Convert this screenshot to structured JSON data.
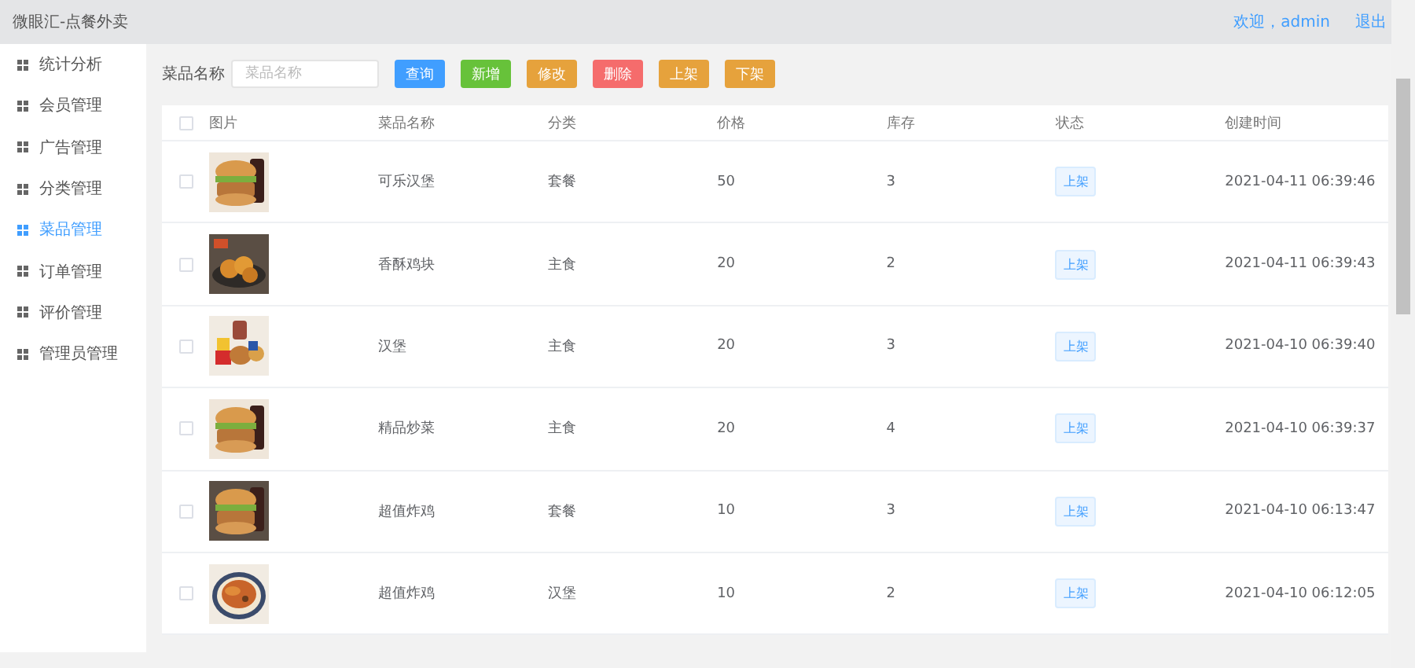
{
  "header": {
    "title": "微眼汇-点餐外卖",
    "user": "欢迎，admin",
    "logout": "退出"
  },
  "sidebar": {
    "items": [
      {
        "label": "统计分析",
        "selected": false
      },
      {
        "label": "会员管理",
        "selected": false
      },
      {
        "label": "广告管理",
        "selected": false
      },
      {
        "label": "分类管理",
        "selected": false
      },
      {
        "label": "菜品管理",
        "selected": true
      },
      {
        "label": "订单管理",
        "selected": false
      },
      {
        "label": "评价管理",
        "selected": false
      },
      {
        "label": "管理员管理",
        "selected": false
      }
    ]
  },
  "toolbar": {
    "search_label": "菜品名称",
    "search": {
      "placeholder": "菜品名称"
    },
    "buttons": [
      {
        "label": "查询",
        "kind": "primary"
      },
      {
        "label": "新增",
        "kind": "success"
      },
      {
        "label": "修改",
        "kind": "warning"
      },
      {
        "label": "删除",
        "kind": "danger"
      },
      {
        "label": "上架",
        "kind": "warning"
      },
      {
        "label": "下架",
        "kind": "warning"
      }
    ]
  },
  "table": {
    "all_checked": false,
    "columns": [
      "图片",
      "菜品名称",
      "分类",
      "价格",
      "库存",
      "状态",
      "创建时间"
    ],
    "rows": [
      {
        "checked": false,
        "name": "可乐汉堡",
        "category": "套餐",
        "price": "50",
        "stock": "3",
        "status": "上架",
        "created": "2021-04-11 06:39:46"
      },
      {
        "checked": false,
        "name": "香酥鸡块",
        "category": "主食",
        "price": "20",
        "stock": "2",
        "status": "上架",
        "created": "2021-04-11 06:39:43"
      },
      {
        "checked": false,
        "name": "汉堡",
        "category": "主食",
        "price": "20",
        "stock": "3",
        "status": "上架",
        "created": "2021-04-10 06:39:40"
      },
      {
        "checked": false,
        "name": "精品炒菜",
        "category": "主食",
        "price": "20",
        "stock": "4",
        "status": "上架",
        "created": "2021-04-10 06:39:37"
      },
      {
        "checked": false,
        "name": "超值炸鸡",
        "category": "套餐",
        "price": "10",
        "stock": "3",
        "status": "上架",
        "created": "2021-04-10 06:13:47"
      },
      {
        "checked": false,
        "name": "超值炸鸡",
        "category": "汉堡",
        "price": "10",
        "stock": "2",
        "status": "上架",
        "created": "2021-04-10 06:12:05"
      }
    ]
  }
}
